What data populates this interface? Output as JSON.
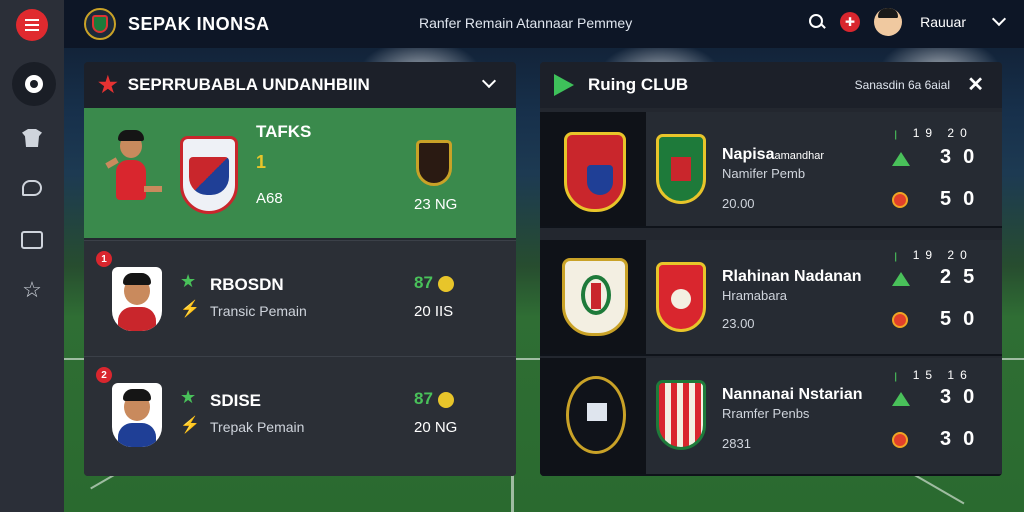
{
  "header": {
    "app_title": "SEPAK INONSA",
    "subtitle": "Ranfer Remain Atannaar Pemmey",
    "username": "Rauuar"
  },
  "sidebar": {
    "items": [
      {
        "icon": "ball-icon"
      },
      {
        "icon": "shirt-icon"
      },
      {
        "icon": "whistle-icon"
      },
      {
        "icon": "board-icon"
      },
      {
        "icon": "star-icon"
      }
    ]
  },
  "left_panel": {
    "title": "SEPRRUBABLA UNDANHBIIN",
    "featured": {
      "label": "TAFKS",
      "rank": "1",
      "code": "A68",
      "score": "23 NG"
    },
    "players": [
      {
        "number": "1",
        "name": "RBOSDN",
        "role": "Transic Pemain",
        "rating": "87",
        "value": "20 IIS"
      },
      {
        "number": "2",
        "name": "SDISE",
        "role": "Trepak Pemain",
        "rating": "87",
        "value": "20 NG"
      }
    ]
  },
  "right_panel": {
    "title": "Ruing CLUB",
    "meta": "Sanasdin 6a 6aial",
    "col_headers": [
      "ꞁ",
      "19",
      "20"
    ],
    "clubs": [
      {
        "name": "Napisa",
        "name_suffix": "amandhar",
        "sub": "Namifer Pemb",
        "value": "20.00",
        "score_top": [
          "3",
          "0"
        ],
        "score_bottom": [
          "5",
          "0"
        ],
        "headers": [
          "ꞁ",
          "19",
          "20"
        ]
      },
      {
        "name": "Rlahinan Nadanan",
        "name_suffix": "",
        "sub": "Hramabara",
        "value": "23.00",
        "score_top": [
          "2",
          "5"
        ],
        "score_bottom": [
          "5",
          "0"
        ],
        "headers": [
          "ꞁ",
          "19",
          "20"
        ]
      },
      {
        "name": "Nannanai Nstarian",
        "name_suffix": "",
        "sub": "Rramfer Penbs",
        "value": "2831",
        "score_top": [
          "3",
          "0"
        ],
        "score_bottom": [
          "3",
          "0"
        ],
        "headers": [
          "ꞁ",
          "15",
          "16"
        ]
      }
    ]
  },
  "colors": {
    "accent_red": "#e02a2f",
    "accent_green": "#49c15a",
    "featured_green": "#3a8a4c",
    "panel_bg": "#23272f"
  }
}
